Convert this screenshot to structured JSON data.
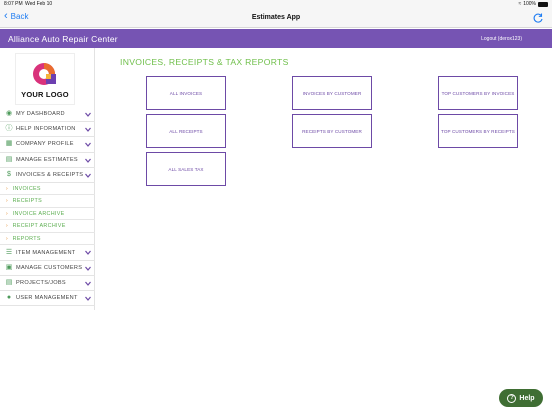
{
  "statusbar": {
    "time": "8:07 PM",
    "date": "Wed Feb 10",
    "battery": "100%"
  },
  "navbar": {
    "back_label": "Back",
    "title": "Estimates App"
  },
  "header": {
    "company": "Alliance Auto Repair Center",
    "logout": "Logout (derox123)"
  },
  "logo": {
    "text": "YOUR LOGO"
  },
  "sidebar": {
    "items": [
      {
        "label": "MY DASHBOARD",
        "icon": "dashboard-icon"
      },
      {
        "label": "HELP INFORMATION",
        "icon": "info-icon"
      },
      {
        "label": "COMPANY PROFILE",
        "icon": "building-icon"
      },
      {
        "label": "MANAGE ESTIMATES",
        "icon": "document-icon"
      },
      {
        "label": "INVOICES & RECEIPTS",
        "icon": "dollar-icon"
      }
    ],
    "subitems": [
      {
        "label": "INVOICES"
      },
      {
        "label": "RECEIPTS"
      },
      {
        "label": "INVOICE ARCHIVE"
      },
      {
        "label": "RECEIPT ARCHIVE"
      },
      {
        "label": "REPORTS"
      }
    ],
    "items_after": [
      {
        "label": "ITEM MANAGEMENT",
        "icon": "list-icon"
      },
      {
        "label": "MANAGE CUSTOMERS",
        "icon": "contact-icon"
      },
      {
        "label": "PROJECTS/JOBS",
        "icon": "briefcase-icon"
      },
      {
        "label": "USER MANAGEMENT",
        "icon": "users-icon"
      }
    ]
  },
  "main": {
    "title": "INVOICES, RECEIPTS & TAX REPORTS",
    "buttons": [
      {
        "label": "ALL INVOICES"
      },
      {
        "label": "INVOICES BY CUSTOMER"
      },
      {
        "label": "TOP CUSTOMERS BY INVOICES"
      },
      {
        "label": "ALL RECEIPTS"
      },
      {
        "label": "RECEIPTS BY CUSTOMER"
      },
      {
        "label": "TOP CUSTOMERS BY RECEIPTS"
      },
      {
        "label": "ALL SALES TAX"
      }
    ]
  },
  "help": {
    "label": "Help"
  },
  "colors": {
    "header": "#7654b3",
    "accent_green": "#6fbf4a",
    "button_border": "#6d4aa6",
    "ios_blue": "#1e7cf2"
  }
}
